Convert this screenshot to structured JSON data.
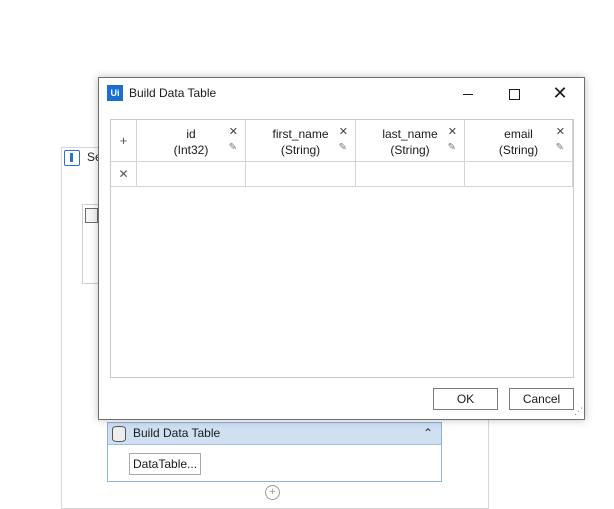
{
  "background": {
    "sequence_label": "Se",
    "build_data_table_card": {
      "title": "Build Data Table",
      "datatable_button": "DataTable...",
      "collapse_icon": "double-chevron-up-icon"
    },
    "add_icon": "plus-circle-icon"
  },
  "dialog": {
    "app_icon_text": "Ui",
    "title": "Build Data Table",
    "minimize_icon": "minimize-icon",
    "maximize_icon": "maximize-icon",
    "close_icon": "close-icon",
    "close_glyph": "✕",
    "add_column_glyph": "+",
    "columns": [
      {
        "name": "id",
        "type": "(Int32)"
      },
      {
        "name": "first_name",
        "type": "(String)"
      },
      {
        "name": "last_name",
        "type": "(String)"
      },
      {
        "name": "email",
        "type": "(String)"
      }
    ],
    "delete_glyph": "✕",
    "edit_glyph": "✎",
    "row_delete_glyph": "✕",
    "ok_label": "OK",
    "cancel_label": "Cancel"
  }
}
